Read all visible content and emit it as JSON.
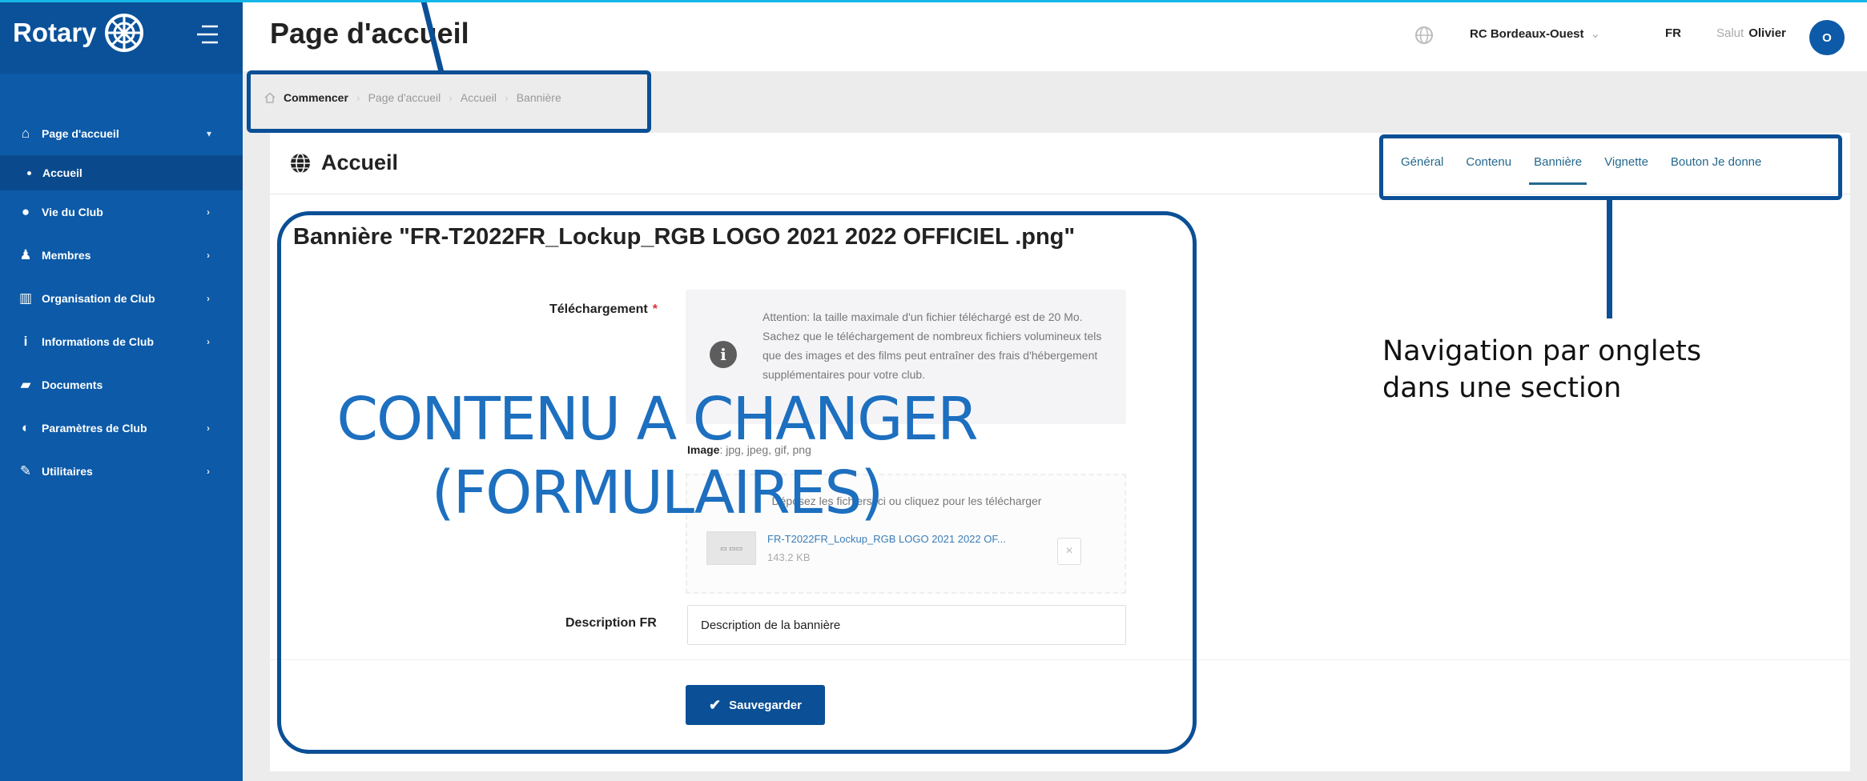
{
  "app": {
    "brand": "Rotary",
    "accent": "#0c5aa8",
    "annotation_color": "#0b4f96"
  },
  "sidebar": {
    "items": [
      {
        "label": "Page d'accueil",
        "icon": "home-icon",
        "chevron": "▾"
      },
      {
        "label": "Accueil",
        "sub": true
      },
      {
        "label": "Vie du Club",
        "icon": "globe-icon",
        "chevron": "›"
      },
      {
        "label": "Membres",
        "icon": "user-icon",
        "chevron": "›"
      },
      {
        "label": "Organisation de Club",
        "icon": "institution-icon",
        "chevron": "›"
      },
      {
        "label": "Informations de Club",
        "icon": "info-icon",
        "chevron": "›"
      },
      {
        "label": "Documents",
        "icon": "folder-icon",
        "chevron": ""
      },
      {
        "label": "Paramètres de Club",
        "icon": "toggle-icon",
        "chevron": "›"
      },
      {
        "label": "Utilitaires",
        "icon": "wrench-icon",
        "chevron": "›"
      }
    ]
  },
  "header": {
    "title": "Page d'accueil",
    "club": "RC Bordeaux-Ouest",
    "club_caret": "⌄",
    "lang": "FR",
    "greeting": "Salut",
    "user": "Olivier",
    "avatar_initial": "O"
  },
  "breadcrumb": {
    "items": [
      "Commencer",
      "Page d'accueil",
      "Accueil",
      "Bannière"
    ],
    "separator": "›"
  },
  "section": {
    "title": "Accueil",
    "tabs": [
      "Général",
      "Contenu",
      "Bannière",
      "Vignette",
      "Bouton Je donne"
    ],
    "active_tab": "Bannière"
  },
  "form": {
    "banner_title": "Bannière \"FR-T2022FR_Lockup_RGB LOGO 2021 2022 OFFICIEL .png\"",
    "upload_label": "Téléchargement",
    "required_mark": "*",
    "alert_text": "Attention: la taille maximale d'un fichier téléchargé est de 20 Mo. Sachez que le téléchargement de nombreux fichiers volumineux tels que des images et des films peut entraîner des frais d'hébergement supplémentaires pour votre club.",
    "accepted_label": "Image",
    "accepted_types": "jpg, jpeg, gif, png",
    "dropzone_hint": "Déposez les fichiers ici ou cliquez pour les télécharger",
    "file_name": "FR-T2022FR_Lockup_RGB LOGO 2021 2022 OF...",
    "file_size": "143.2 KB",
    "remove_icon": "×",
    "desc_label": "Description FR",
    "desc_value": "Description de la bannière",
    "save_label": "Sauvegarder"
  },
  "annotations": {
    "content_note": "CONTENU A CHANGER (FORMULAIRES)",
    "tabs_note_line1": "Navigation par onglets",
    "tabs_note_line2": "dans une section"
  }
}
